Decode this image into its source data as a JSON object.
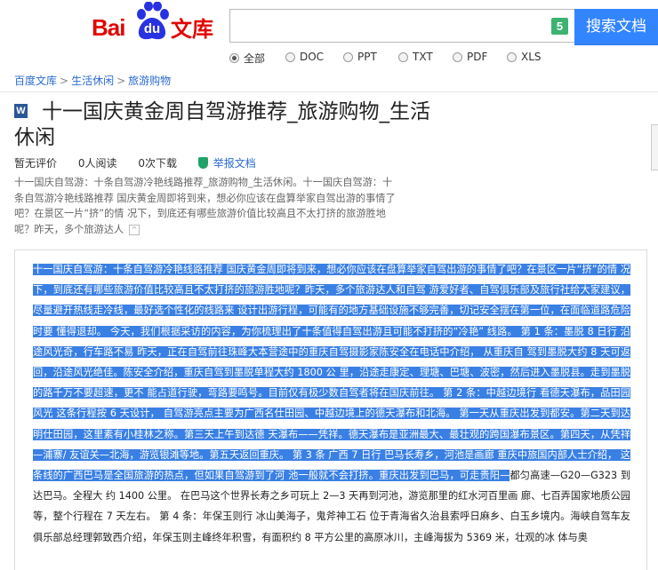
{
  "header": {
    "logo_bai": "Bai",
    "logo_du": "du",
    "logo_wenku": "文库",
    "search_value": "",
    "search_badge": "5",
    "search_button": "搜索文档"
  },
  "filters": [
    {
      "label": "全部",
      "checked": true
    },
    {
      "label": "DOC",
      "checked": false
    },
    {
      "label": "PPT",
      "checked": false
    },
    {
      "label": "TXT",
      "checked": false
    },
    {
      "label": "PDF",
      "checked": false
    },
    {
      "label": "XLS",
      "checked": false
    }
  ],
  "breadcrumb": [
    "百度文库",
    "生活休闲",
    "旅游购物"
  ],
  "breadcrumb_sep": ">",
  "doc_icon_letter": "W",
  "title": "十一国庆黄金周自驾游推荐_旅游购物_生活休闲",
  "meta": {
    "rating": "暂无评价",
    "reads": "0人阅读",
    "downloads": "0次下载",
    "report": "举报文档"
  },
  "summary": "十一国庆自驾游：十条自驾游冷艳线路推荐_旅游购物_生活休闲。十一国庆自驾游：十条自驾游冷艳线路推荐 国庆黄金周即将到来，想必你应该在盘算举家自驾出游的事情了吧？在景区一片“挤”的情 况下，到底还有哪些旅游价值比较高且不太打挤的旅游胜地呢？昨天，多个旅游达人",
  "content": {
    "selected": "十一国庆自驾游：十条自驾游冷艳线路推荐 国庆黄金周即将到来，想必你应该在盘算举家自驾出游的事情了吧？在景区一片“挤”的情 况下，到底还有哪些旅游价值比较高且不太打挤的旅游胜地呢？昨天，多个旅游达人和自驾 游爱好者、自驾俱乐部及旅行社给大家建议，尽量避开热线走冷线，最好选个性化的线路来 设计出游行程，可能有的地方基础设施不够完善，切记安全摆在第一位，在面临道路危险时要 懂得退却。 今天，我们根据采访的内容，为你梳理出了十条值得自驾出游且可能不打挤的“冷艳” 线路。 第 1 条：墨脱 8 日行 沿途风光奇，行车路不易 昨天，正在自驾前往珠峰大本营途中的重庆自驾摄影家陈安全在电话中介绍， 从重庆自 驾到墨脱大约 8 天可返回，沿途风光绝佳。陈安全介绍，重庆自驾到墨脱单程大约 1800 公 里，沿途走康定、理塘、巴塘、波密，然后进入墨脱县。走到墨脱的路千万不要超速，更不 能占道行驶，弯路要鸣号。目前仅有极少数自驾者将在国庆前往。 第 2 条：中越边境行 看德天瀑布，品田园风光 这条行程按 6 天设计， 自驾游亮点主要为广西名仕田园、中越边境上的德天瀑布和北海。 第一天从重庆出发到都安。第二天到达明仕田园，这里素有小桂林之称。第三天上午到达德 天瀑布——凭祥。德天瀑布是亚洲最大、最壮观的跨国瀑布景区。第四天，从凭祥—浦寨/ 友谊关—北海，游览银滩等地。第五天返回重庆。 第 3 条 广西 7 日行 巴马长寿乡，河池是画廊 重庆中旅国内部人士介绍， 这条线的广西巴马是全国旅游的热点，但如果自驾游到了河 池一般就不会打挤。重庆出发到巴马，可走贵阳—",
    "rest": "都匀高速—G20—G323 到达巴马。全程大 约 1400 公里。 在巴马这个世界长寿之乡可玩上 2—3 天再到河池，游览那里的红水河百里画 廊、七百弄国家地质公园等，整个行程在 7 天左右。 第 4 条：年保玉则行 冰山美海子，鬼斧神工石 位于青海省久治县索呼日麻乡、白玉乡境内。海峡自驾车友俱乐部总经理郭致西介绍，年保玉则主峰终年积雪，有面积约 8 平方公里的高原冰川，主峰海拔为 5369 米，壮观的冰 体与奥"
  }
}
